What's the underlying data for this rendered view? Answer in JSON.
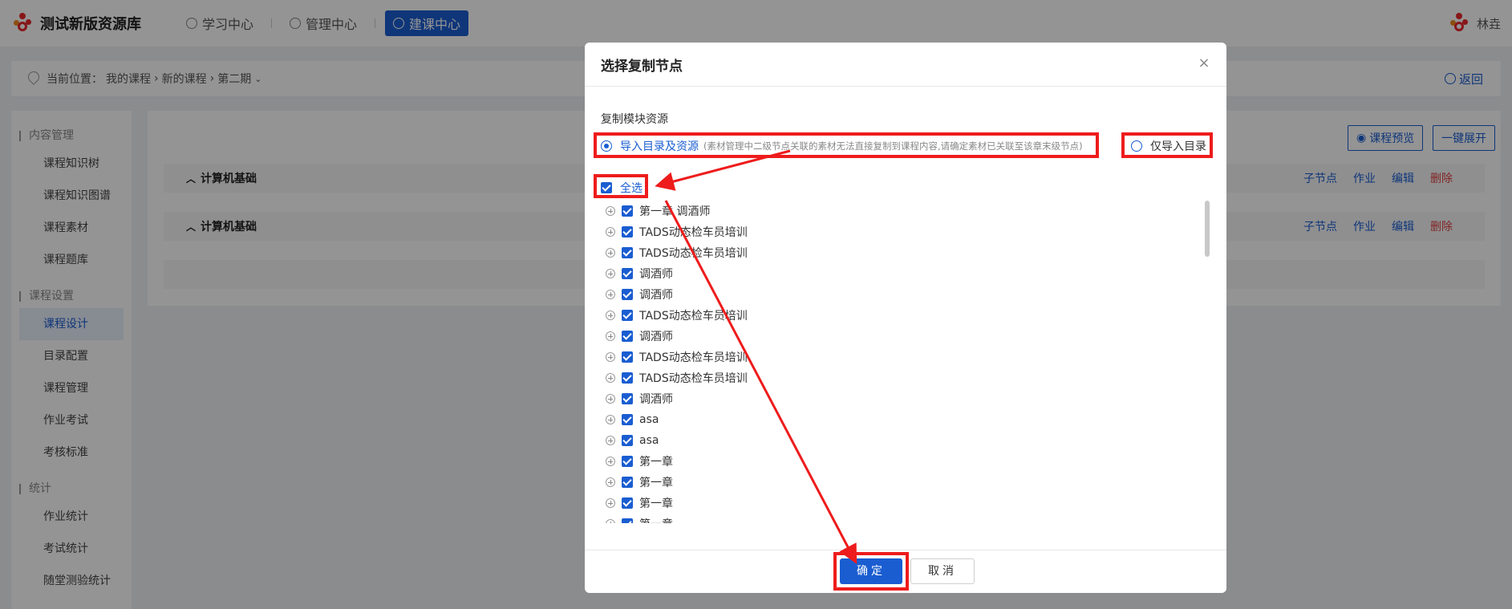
{
  "header": {
    "logo_text": "测试新版资源库",
    "nav": [
      {
        "label": "学习中心",
        "active": false
      },
      {
        "label": "管理中心",
        "active": false
      },
      {
        "label": "建课中心",
        "active": true
      }
    ],
    "user_name": "林垚"
  },
  "breadcrumb": {
    "prefix": "当前位置：",
    "items": [
      "我的课程",
      "新的课程",
      "第二期"
    ],
    "back_label": "返回"
  },
  "sidebar": {
    "groups": [
      {
        "title": "内容管理",
        "items": [
          "课程知识树",
          "课程知识图谱",
          "课程素材",
          "课程题库"
        ]
      },
      {
        "title": "课程设置",
        "items": [
          "课程设计",
          "目录配置",
          "课程管理",
          "作业考试",
          "考核标准"
        ]
      },
      {
        "title": "统计",
        "items": [
          "作业统计",
          "考试统计",
          "随堂测验统计"
        ]
      }
    ],
    "active_item": "课程设计"
  },
  "content": {
    "preview_button": "课程预览",
    "expand_button": "一键展开",
    "rows": [
      {
        "title": "计算机基础",
        "actions": [
          "子节点",
          "作业",
          "编辑",
          "删除"
        ]
      },
      {
        "title": "计算机基础",
        "actions": [
          "子节点",
          "作业",
          "编辑",
          "删除"
        ]
      }
    ]
  },
  "modal": {
    "title": "选择复制节点",
    "close_glyph": "×",
    "section_label": "复制模块资源",
    "option_full_label": "导入目录及资源",
    "option_full_note": "(素材管理中二级节点关联的素材无法直接复制到课程内容,请确定素材已关联至该章末级节点)",
    "option_dir_label": "仅导入目录",
    "select_all_label": "全选",
    "tree_items": [
      "第一章 调酒师",
      "TADS动态检车员培训",
      "TADS动态检车员培训",
      "调酒师",
      "调酒师",
      "TADS动态检车员培训",
      "调酒师",
      "TADS动态检车员培训",
      "TADS动态检车员培训",
      "调酒师",
      "asa",
      "asa",
      "第一章",
      "第一章",
      "第一章",
      "第一章"
    ],
    "ok_label": "确定",
    "cancel_label": "取消"
  },
  "colors": {
    "primary": "#1a5dd1",
    "annotation": "#ee1c1c",
    "danger": "#e04040"
  }
}
